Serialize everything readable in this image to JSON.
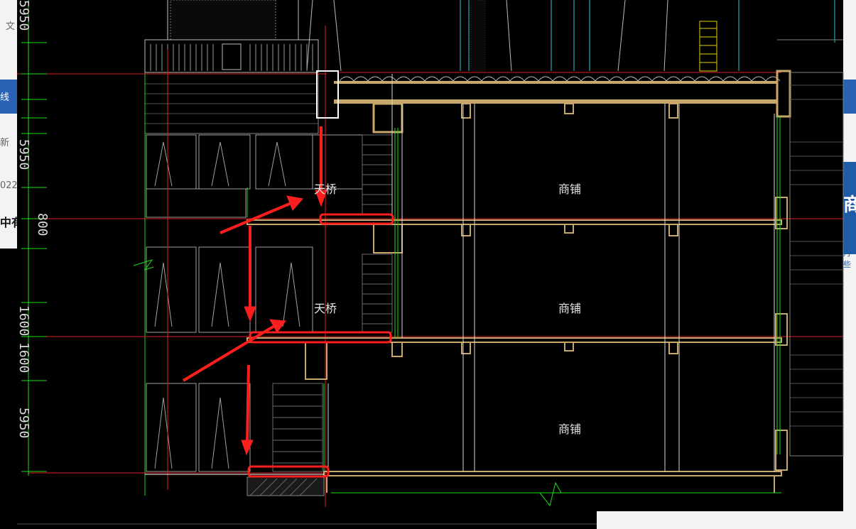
{
  "labels": {
    "bridge_upper": "天桥",
    "bridge_middle": "天桥",
    "shop_upper": "商铺",
    "shop_middle": "商铺",
    "shop_lower": "商铺"
  },
  "dimensions": {
    "d1": "800",
    "d2": "5950",
    "d3": "1600",
    "d4": "5950",
    "d5": "1600",
    "d6": "5950"
  },
  "background_fragments": {
    "left_text_1": "文",
    "left_text_2": "线",
    "left_text_3": "新",
    "left_text_4": "022",
    "left_text_5": "中有",
    "right_text_1": "商",
    "right_text_2": "丹些"
  },
  "colors": {
    "slab": "#c8a86a",
    "structure_line": "#ffffff",
    "guide_red": "#e02020",
    "green": "#19e019",
    "cyan": "#1fd0d0",
    "annotation_red": "#ff1e1e"
  }
}
